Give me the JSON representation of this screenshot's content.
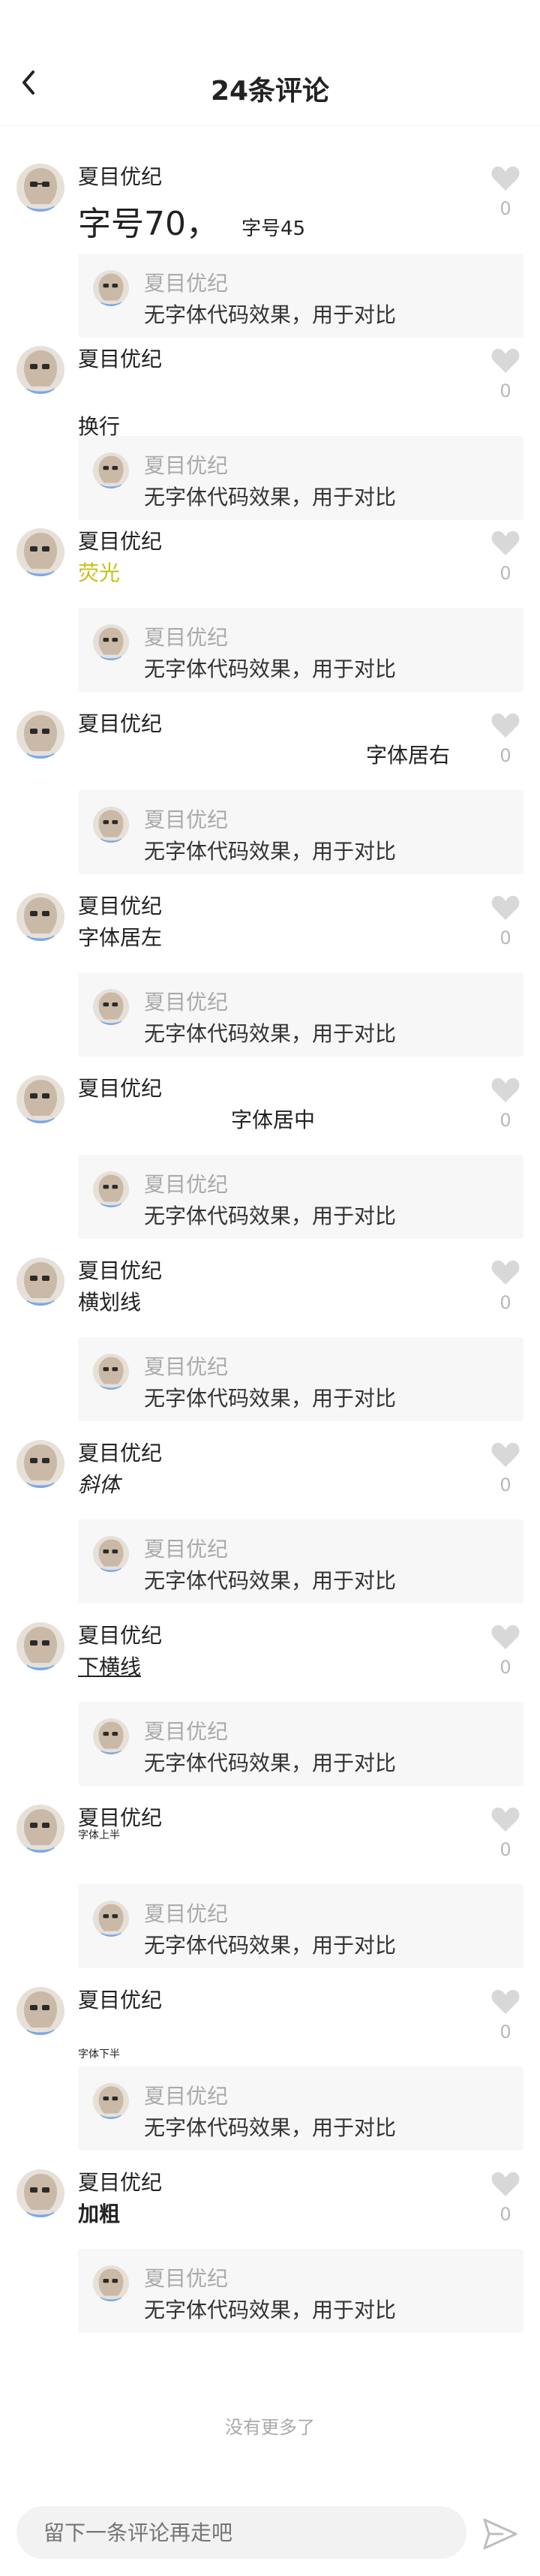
{
  "header": {
    "title": "24条评论",
    "back_icon": "chevron-left-icon"
  },
  "user_name": "夏目优纪",
  "reply": {
    "name": "夏目优纪",
    "text": "无字体代码效果，用于对比"
  },
  "comments": [
    {
      "text_big": "字号70，",
      "text_small": "字号45",
      "likes": "0"
    },
    {
      "text": "换行",
      "likes": "0"
    },
    {
      "text": "荧光",
      "likes": "0"
    },
    {
      "text": "字体居右",
      "likes": "0"
    },
    {
      "text": "字体居左",
      "likes": "0"
    },
    {
      "text": "字体居中",
      "likes": "0"
    },
    {
      "text": "横划线",
      "likes": "0"
    },
    {
      "text": "斜体",
      "likes": "0"
    },
    {
      "text": "下横线",
      "likes": "0"
    },
    {
      "text": "字体上半",
      "likes": "0"
    },
    {
      "text": "字体下半",
      "likes": "0"
    },
    {
      "text": "加粗",
      "likes": "0"
    }
  ],
  "footer": {
    "no_more": "没有更多了",
    "input_placeholder": "留下一条评论再走吧"
  },
  "colors": {
    "glow": "#c7c01a",
    "like_icon": "#d8d8d8",
    "send_icon": "#bdbdbd"
  }
}
